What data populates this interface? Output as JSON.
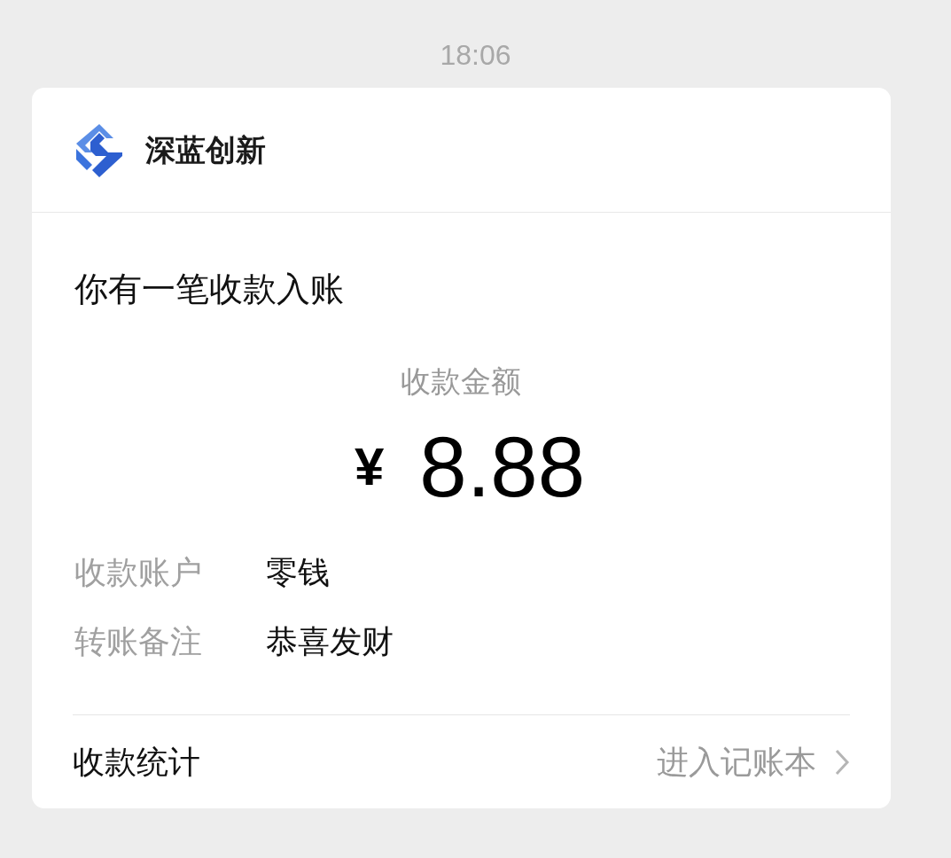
{
  "time": "18:06",
  "card": {
    "sender": "深蓝创新",
    "title": "你有一笔收款入账",
    "amount_label": "收款金额",
    "currency": "¥",
    "amount": "8.88",
    "details": [
      {
        "label": "收款账户",
        "value": "零钱"
      },
      {
        "label": "转账备注",
        "value": "恭喜发财"
      }
    ],
    "footer": {
      "label": "收款统计",
      "link": "进入记账本"
    }
  }
}
